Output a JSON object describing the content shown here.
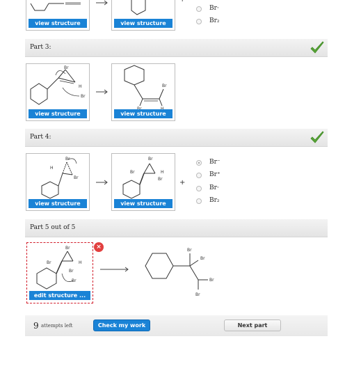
{
  "parts": [
    {
      "title": "",
      "status": "complete"
    },
    {
      "title": "Part 3:",
      "status": "correct"
    },
    {
      "title": "Part 4:",
      "status": "correct"
    },
    {
      "title": "Part 5 out of 5",
      "status": "active"
    }
  ],
  "part2": {
    "reactant_button": "view structure",
    "product_button": "view structure",
    "options": [
      {
        "label": "Br·",
        "selected": false
      },
      {
        "label": "Br₂",
        "selected": false
      }
    ]
  },
  "part3": {
    "reactant_button": "view structure",
    "product_button": "view structure"
  },
  "part4": {
    "reactant_button": "view structure",
    "product_button": "view structure",
    "plus": "+",
    "options": [
      {
        "label": "Br⁻",
        "selected": true
      },
      {
        "label": "Br⁺",
        "selected": false
      },
      {
        "label": "Br·",
        "selected": false
      },
      {
        "label": "Br₂",
        "selected": false
      }
    ]
  },
  "part5": {
    "edit_button": "edit structure ...",
    "close_badge": "×",
    "product_labels": [
      "Br",
      "Br",
      "Br",
      "Br"
    ]
  },
  "footer": {
    "attempts_count": "9",
    "attempts_text": "attempts left",
    "check_button": "Check my work",
    "next_button": "Next part"
  },
  "colors": {
    "accent": "#1a83d6",
    "check_green": "#5aa537",
    "error_red": "#d21e2b"
  }
}
